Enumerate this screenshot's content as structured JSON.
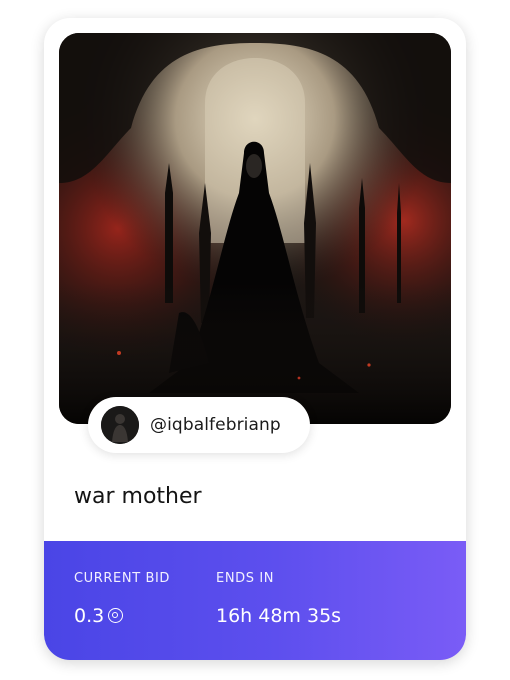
{
  "creator": {
    "handle": "@iqbalfebrianp"
  },
  "nft": {
    "title": "war mother"
  },
  "auction": {
    "current_bid_label": "CURRENT BID",
    "current_bid_value": "0.3",
    "currency_icon": "eth-ring-icon",
    "ends_in_label": "ENDS IN",
    "ends_in_value": "16h 48m 35s"
  },
  "colors": {
    "gradient_start": "#4a45e6",
    "gradient_end": "#7a5cf6",
    "card_background": "#ffffff",
    "text_dark": "#141414"
  }
}
